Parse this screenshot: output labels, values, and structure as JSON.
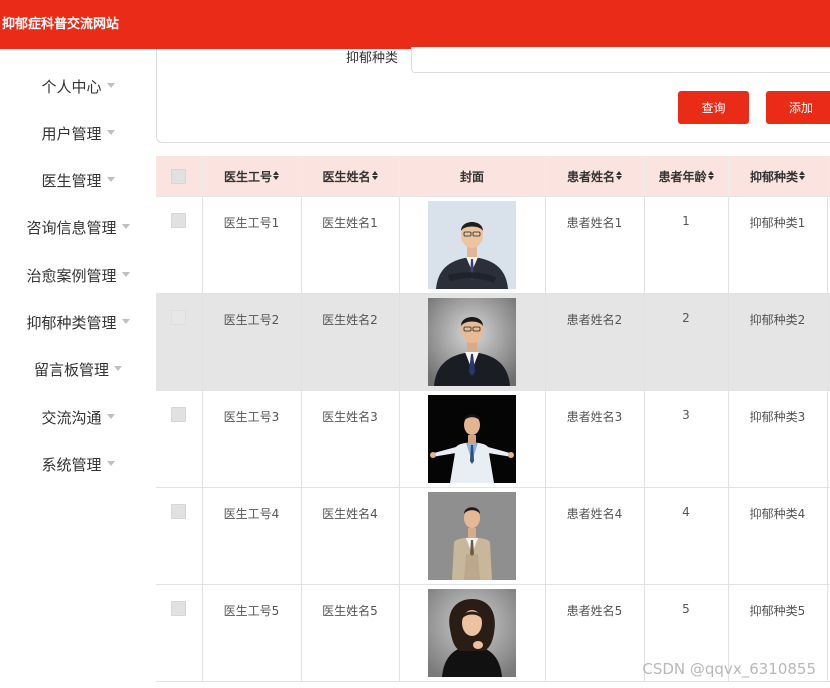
{
  "header": {
    "site_title": "抑郁症科普交流网站"
  },
  "sidebar": {
    "items": [
      {
        "label": "个人中心"
      },
      {
        "label": "用户管理"
      },
      {
        "label": "医生管理"
      },
      {
        "label": "咨询信息管理"
      },
      {
        "label": "治愈案例管理"
      },
      {
        "label": "抑郁种类管理"
      },
      {
        "label": "留言板管理"
      },
      {
        "label": "交流沟通"
      },
      {
        "label": "系统管理"
      }
    ]
  },
  "search": {
    "label": "抑郁种类",
    "value": "",
    "query_label": "查询",
    "add_label": "添加"
  },
  "table": {
    "headers": {
      "doctor_no": "医生工号",
      "doctor_name": "医生姓名",
      "cover": "封面",
      "patient_name": "患者姓名",
      "patient_age": "患者年龄",
      "depression_type": "抑郁种类"
    },
    "rows": [
      {
        "doctor_no": "医生工号1",
        "doctor_name": "医生姓名1",
        "patient_name": "患者姓名1",
        "patient_age": "1",
        "depression_type": "抑郁种类1"
      },
      {
        "doctor_no": "医生工号2",
        "doctor_name": "医生姓名2",
        "patient_name": "患者姓名2",
        "patient_age": "2",
        "depression_type": "抑郁种类2"
      },
      {
        "doctor_no": "医生工号3",
        "doctor_name": "医生姓名3",
        "patient_name": "患者姓名3",
        "patient_age": "3",
        "depression_type": "抑郁种类3"
      },
      {
        "doctor_no": "医生工号4",
        "doctor_name": "医生姓名4",
        "patient_name": "患者姓名4",
        "patient_age": "4",
        "depression_type": "抑郁种类4"
      },
      {
        "doctor_no": "医生工号5",
        "doctor_name": "医生姓名5",
        "patient_name": "患者姓名5",
        "patient_age": "5",
        "depression_type": "抑郁种类5"
      }
    ]
  },
  "watermark": "CSDN @qqvx_6310855",
  "colors": {
    "brand": "#ea2b17",
    "header_row": "#fbe4e0",
    "striped_row": "#e5e5e5"
  }
}
